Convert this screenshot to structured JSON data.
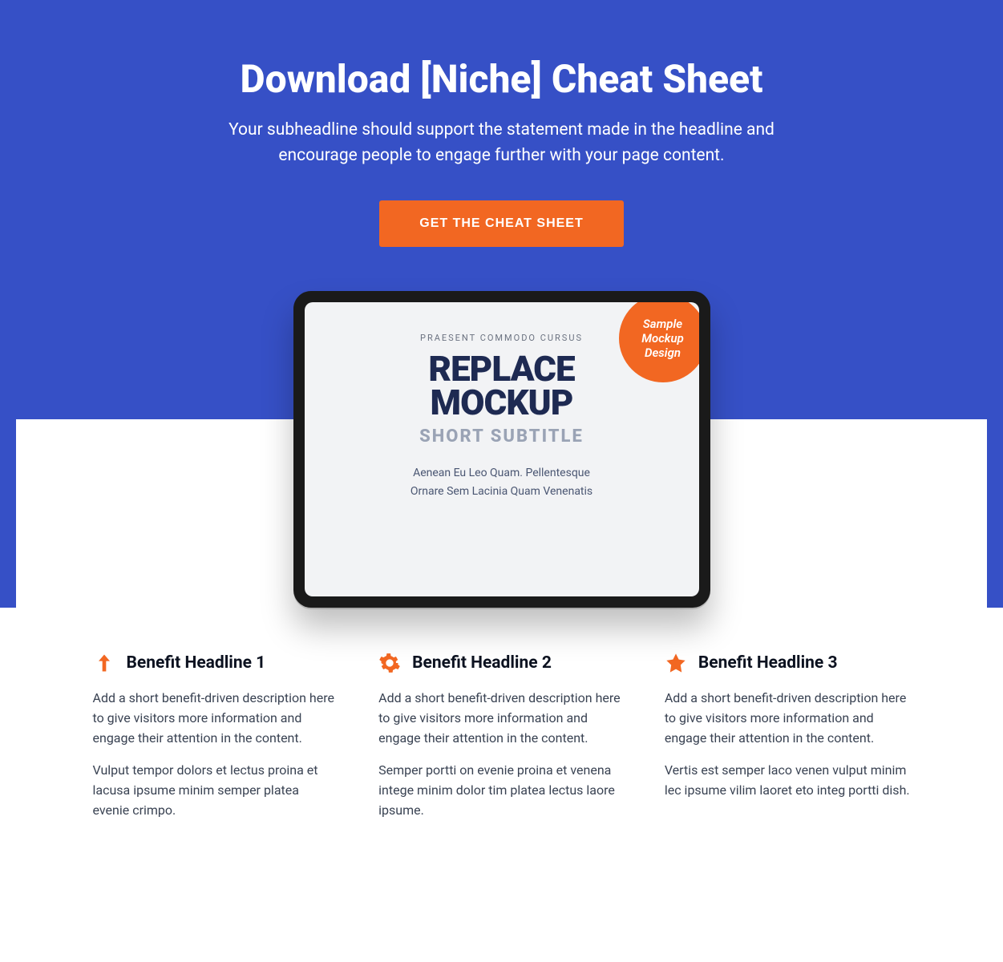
{
  "hero": {
    "headline": "Download [Niche] Cheat Sheet",
    "subheadline": "Your subheadline should support the statement made in the headline and encourage people to engage further with your page content.",
    "cta_label": "GET THE CHEAT SHEET"
  },
  "mockup": {
    "badge_line1": "Sample",
    "badge_line2": "Mockup",
    "badge_line3": "Design",
    "eyebrow": "PRAESENT COMMODO CURSUS",
    "title_line1": "REPLACE",
    "title_line2": "MOCKUP",
    "subtitle": "SHORT SUBTITLE",
    "body_line1": "Aenean Eu Leo Quam. Pellentesque",
    "body_line2": "Ornare Sem Lacinia Quam Venenatis"
  },
  "benefits": [
    {
      "icon": "arrow-up",
      "headline": "Benefit Headline 1",
      "p1": "Add a short benefit-driven description here to give visitors more information and engage their attention in the content.",
      "p2": "Vulput tempor dolors et lectus proina et lacusa ipsume minim semper platea evenie crimpo."
    },
    {
      "icon": "gear",
      "headline": "Benefit Headline 2",
      "p1": "Add a short benefit-driven description here to give visitors more information and engage their attention in the content.",
      "p2": "Semper portti on evenie proina et venena intege minim dolor tim platea lectus laore ipsume."
    },
    {
      "icon": "star",
      "headline": "Benefit Headline 3",
      "p1": "Add a short benefit-driven description here to give visitors more information and engage their attention in the content.",
      "p2": "Vertis est semper laco venen vulput minim lec ipsume vilim laoret eto integ portti dish."
    }
  ],
  "colors": {
    "primary_bg": "#3650c6",
    "accent": "#f26722"
  }
}
